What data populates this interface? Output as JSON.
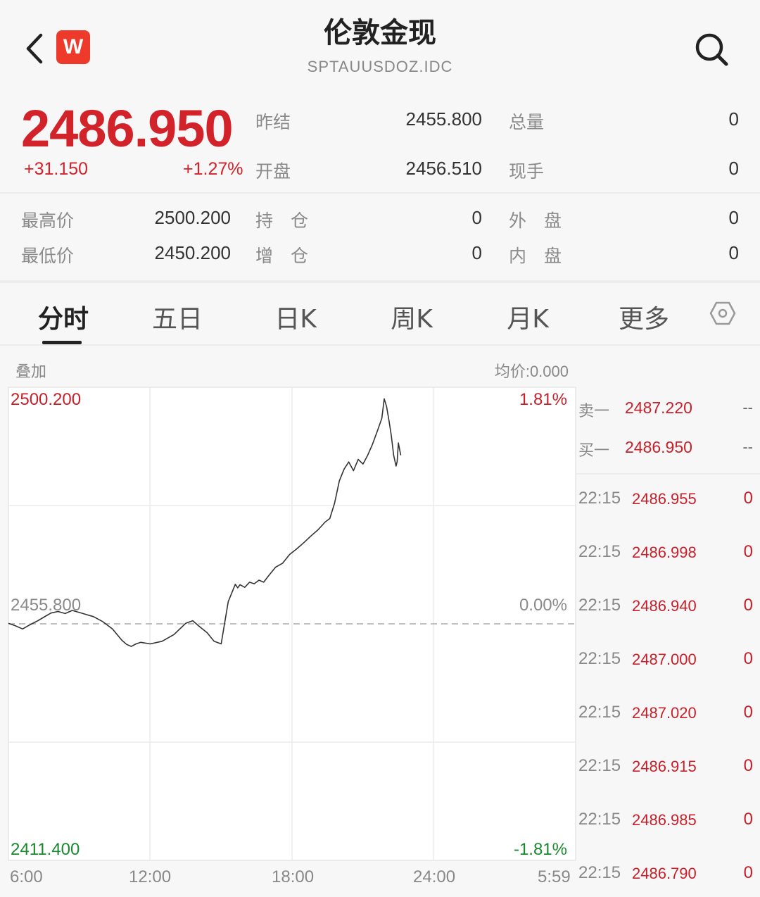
{
  "header": {
    "title": "伦敦金现",
    "code": "SPTAUUSDOZ.IDC",
    "logo_letter": "W"
  },
  "quote": {
    "price": "2486.950",
    "change": "+31.150",
    "change_pct": "+1.27%",
    "prev_settle_label": "昨结",
    "prev_settle": "2455.800",
    "open_label": "开盘",
    "open": "2456.510",
    "total_vol_label": "总量",
    "total_vol": "0",
    "cur_vol_label": "现手",
    "cur_vol": "0",
    "high_label": "最高价",
    "high": "2500.200",
    "low_label": "最低价",
    "low": "2450.200",
    "oi_label": "持　仓",
    "oi": "0",
    "oi_inc_label": "增　仓",
    "oi_inc": "0",
    "outer_label": "外　盘",
    "outer": "0",
    "inner_label": "内　盘",
    "inner": "0"
  },
  "tabs": [
    "分时",
    "五日",
    "日K",
    "周K",
    "月K",
    "更多"
  ],
  "chart_header": {
    "overlay_label": "叠加",
    "avg_price_label": "均价:0.000"
  },
  "chart_data": {
    "type": "line",
    "x_tick_labels": [
      "6:00",
      "12:00",
      "18:00",
      "24:00",
      "5:59"
    ],
    "y_left_labels": [
      "2500.200",
      "2455.800",
      "2411.400"
    ],
    "y_right_labels": [
      "1.81%",
      "0.00%",
      "-1.81%"
    ],
    "ylim": [
      2411.4,
      2500.2
    ],
    "prev_close": 2455.8,
    "x_range_hours": [
      0,
      24
    ],
    "grid": true,
    "series": [
      {
        "x": [
          0,
          0.3,
          0.6,
          0.9,
          1.2,
          1.5,
          1.8,
          2.1,
          2.4,
          2.7,
          3.0,
          3.3,
          3.6,
          4.0,
          4.4,
          4.8,
          5.0,
          5.2,
          5.4,
          5.6,
          6.0,
          6.5,
          7.0,
          7.5,
          7.8,
          8.1,
          8.4,
          8.7,
          9.0,
          9.3,
          9.6,
          9.7,
          9.8,
          10.0,
          10.2,
          10.4,
          10.6,
          10.8,
          11.0,
          11.3,
          11.6,
          11.9,
          12.2,
          12.5,
          12.8,
          13.1,
          13.4,
          13.6,
          13.8,
          14.0,
          14.2,
          14.4,
          14.6,
          14.8,
          15.0,
          15.2,
          15.4,
          15.6,
          15.8,
          15.9,
          16.0,
          16.1,
          16.2,
          16.3,
          16.4,
          16.45,
          16.5,
          16.55,
          16.6
        ],
        "y": [
          2455.9,
          2455.4,
          2454.8,
          2455.6,
          2456.3,
          2457.1,
          2457.9,
          2458.2,
          2457.8,
          2458.4,
          2458.0,
          2457.6,
          2457.2,
          2456.2,
          2454.8,
          2452.6,
          2451.8,
          2451.4,
          2451.9,
          2452.2,
          2451.9,
          2452.4,
          2453.7,
          2455.9,
          2456.4,
          2455.2,
          2454.1,
          2452.4,
          2451.9,
          2460.1,
          2463.5,
          2462.8,
          2463.4,
          2462.9,
          2463.9,
          2463.6,
          2464.3,
          2463.9,
          2465.1,
          2466.8,
          2467.6,
          2469.3,
          2470.4,
          2471.6,
          2472.9,
          2474.1,
          2475.6,
          2476.3,
          2479.3,
          2483.6,
          2485.9,
          2487.3,
          2485.6,
          2487.8,
          2486.9,
          2488.6,
          2490.7,
          2493.2,
          2495.8,
          2499.6,
          2498.1,
          2495.4,
          2492.5,
          2488.6,
          2486.5,
          2487.4,
          2491.0,
          2489.8,
          2488.6
        ]
      }
    ]
  },
  "order_book": [
    {
      "label": "卖一",
      "price": "2487.220",
      "vol": "--"
    },
    {
      "label": "买一",
      "price": "2486.950",
      "vol": "--"
    }
  ],
  "ticks": [
    {
      "time": "22:15",
      "price": "2486.955",
      "vol": "0"
    },
    {
      "time": "22:15",
      "price": "2486.998",
      "vol": "0"
    },
    {
      "time": "22:15",
      "price": "2486.940",
      "vol": "0"
    },
    {
      "time": "22:15",
      "price": "2487.000",
      "vol": "0"
    },
    {
      "time": "22:15",
      "price": "2487.020",
      "vol": "0"
    },
    {
      "time": "22:15",
      "price": "2486.915",
      "vol": "0"
    },
    {
      "time": "22:15",
      "price": "2486.985",
      "vol": "0"
    },
    {
      "time": "22:15",
      "price": "2486.790",
      "vol": "0"
    }
  ]
}
